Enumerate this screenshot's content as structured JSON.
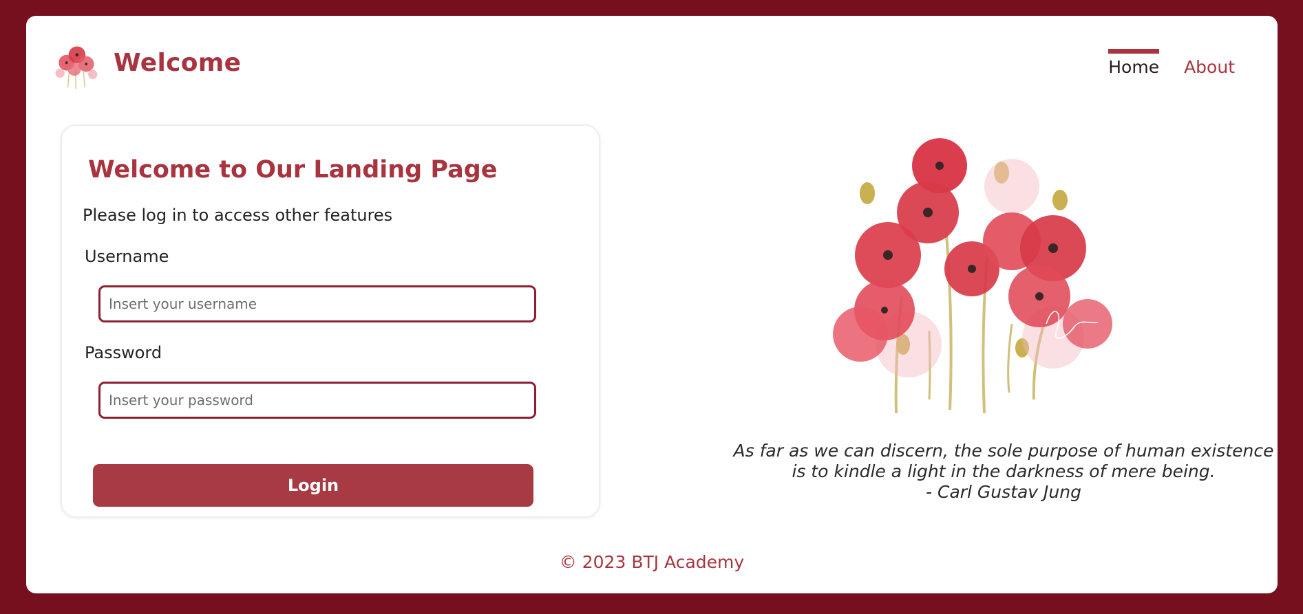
{
  "header": {
    "brand": "Welcome",
    "nav": [
      {
        "label": "Home",
        "active": true
      },
      {
        "label": "About",
        "active": false
      }
    ]
  },
  "login": {
    "title": "Welcome to Our Landing Page",
    "subtitle": "Please log in to access other features",
    "username_label": "Username",
    "username_placeholder": "Insert your username",
    "username_value": "",
    "password_label": "Password",
    "password_placeholder": "Insert your password",
    "password_value": "",
    "button_label": "Login"
  },
  "quote": {
    "lines": [
      "As far as we can discern, the sole purpose of human existence",
      "is to kindle a light in the darkness of mere being.",
      "- Carl Gustav Jung"
    ]
  },
  "illustration": {
    "icon": "poppy-bouquet-illustration",
    "accent_color": "#d83a48"
  },
  "footer": {
    "text": "© 2023 BTJ Academy"
  },
  "colors": {
    "frame": "#76101e",
    "brand": "#a8343f",
    "button": "#a83a43",
    "input_border": "#8e1f30"
  }
}
